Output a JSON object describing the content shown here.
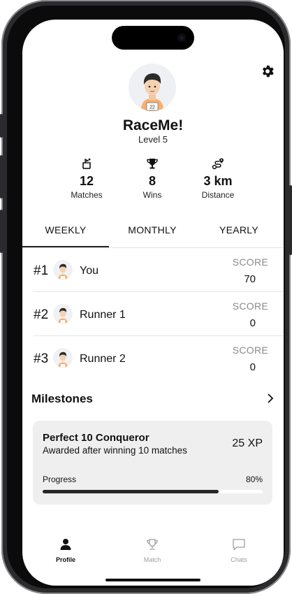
{
  "profile": {
    "name": "RaceMe!",
    "level": "Level 5",
    "avatar_bib": "22"
  },
  "stats": [
    {
      "value": "12",
      "label": "Matches",
      "icon": "matches-icon"
    },
    {
      "value": "8",
      "label": "Wins",
      "icon": "trophy-icon"
    },
    {
      "value": "3 km",
      "label": "Distance",
      "icon": "route-icon"
    }
  ],
  "tabs": [
    {
      "label": "WEEKLY",
      "active": true
    },
    {
      "label": "MONTHLY",
      "active": false
    },
    {
      "label": "YEARLY",
      "active": false
    }
  ],
  "leaderboard": [
    {
      "rank": "#1",
      "name": "You",
      "score_label": "SCORE",
      "score": "70"
    },
    {
      "rank": "#2",
      "name": "Runner 1",
      "score_label": "SCORE",
      "score": "0"
    },
    {
      "rank": "#3",
      "name": "Runner 2",
      "score_label": "SCORE",
      "score": "0"
    }
  ],
  "milestones": {
    "title": "Milestones",
    "card": {
      "title": "Perfect 10 Conqueror",
      "description": "Awarded after winning 10 matches",
      "xp": "25 XP",
      "progress_label": "Progress",
      "progress_text": "80%",
      "progress_value": 0.8
    }
  },
  "bottom_nav": [
    {
      "label": "Profile",
      "icon": "person-icon",
      "active": true
    },
    {
      "label": "Match",
      "icon": "trophy-icon",
      "active": false
    },
    {
      "label": "Chats",
      "icon": "chat-bubble-icon",
      "active": false
    }
  ],
  "colors": {
    "active": "#111111",
    "inactive": "#9e9e9e",
    "avatar_shirt": "#f6b070",
    "card_bg": "#efefef"
  }
}
